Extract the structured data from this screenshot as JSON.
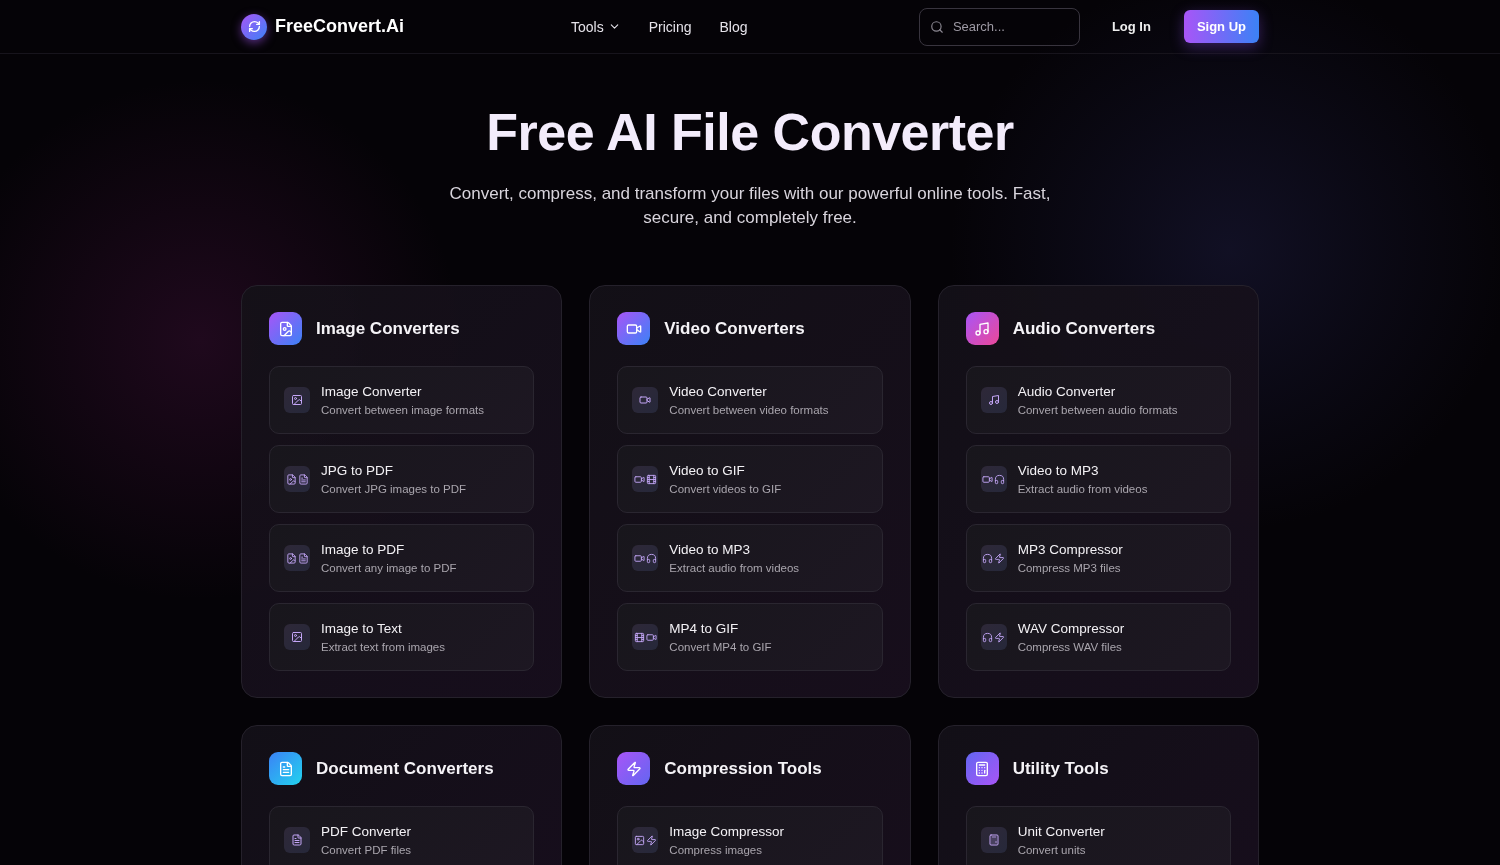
{
  "nav": {
    "brand": "FreeConvert.Ai",
    "links": [
      {
        "label": "Tools",
        "dropdown": true
      },
      {
        "label": "Pricing",
        "dropdown": false
      },
      {
        "label": "Blog",
        "dropdown": false
      }
    ],
    "search": {
      "placeholder": "Search..."
    },
    "login": "Log In",
    "signup": "Sign Up"
  },
  "hero": {
    "title": "Free AI File Converter",
    "subtitle": "Convert, compress, and transform your files with our powerful online tools. Fast, secure, and completely free."
  },
  "categories": [
    {
      "kind": "image",
      "title": "Image Converters",
      "tools": [
        {
          "kind": "image",
          "name": "Image Converter",
          "desc": "Convert between image formats"
        },
        {
          "kind": "imagedoc",
          "name": "JPG to PDF",
          "desc": "Convert JPG images to PDF"
        },
        {
          "kind": "imagedoc",
          "name": "Image to PDF",
          "desc": "Convert any image to PDF"
        },
        {
          "kind": "image",
          "name": "Image to Text",
          "desc": "Extract text from images"
        }
      ]
    },
    {
      "kind": "video",
      "title": "Video Converters",
      "tools": [
        {
          "kind": "video",
          "name": "Video Converter",
          "desc": "Convert between video formats"
        },
        {
          "kind": "videofilm",
          "name": "Video to GIF",
          "desc": "Convert videos to GIF"
        },
        {
          "kind": "videoaudio",
          "name": "Video to MP3",
          "desc": "Extract audio from videos"
        },
        {
          "kind": "filmvideo",
          "name": "MP4 to GIF",
          "desc": "Convert MP4 to GIF"
        }
      ]
    },
    {
      "kind": "audio",
      "title": "Audio Converters",
      "tools": [
        {
          "kind": "audio",
          "name": "Audio Converter",
          "desc": "Convert between audio formats"
        },
        {
          "kind": "videoaudio",
          "name": "Video to MP3",
          "desc": "Extract audio from videos"
        },
        {
          "kind": "audiozap",
          "name": "MP3 Compressor",
          "desc": "Compress MP3 files"
        },
        {
          "kind": "audiozap",
          "name": "WAV Compressor",
          "desc": "Compress WAV files"
        }
      ]
    },
    {
      "kind": "document",
      "title": "Document Converters",
      "tools": [
        {
          "kind": "document",
          "name": "PDF Converter",
          "desc": "Convert PDF files"
        }
      ]
    },
    {
      "kind": "compression",
      "title": "Compression Tools",
      "tools": [
        {
          "kind": "imagezap",
          "name": "Image Compressor",
          "desc": "Compress images"
        }
      ]
    },
    {
      "kind": "utility",
      "title": "Utility Tools",
      "tools": [
        {
          "kind": "calculator",
          "name": "Unit Converter",
          "desc": "Convert units"
        }
      ]
    }
  ]
}
